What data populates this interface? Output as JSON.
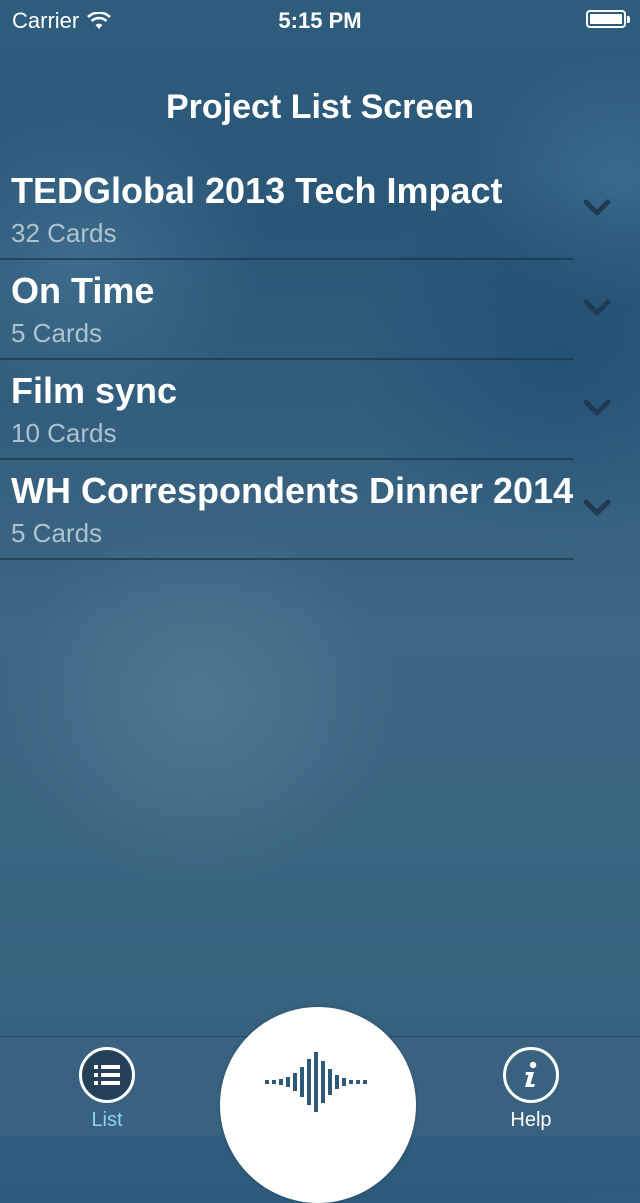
{
  "status_bar": {
    "carrier": "Carrier",
    "time": "5:15 PM",
    "icons": [
      "wifi-icon",
      "battery-icon"
    ]
  },
  "header": {
    "title": "Project List Screen"
  },
  "projects": [
    {
      "name": "TEDGlobal 2013 Tech Impact",
      "count": "32 Cards"
    },
    {
      "name": "On Time",
      "count": "5 Cards"
    },
    {
      "name": "Film sync",
      "count": "10 Cards"
    },
    {
      "name": "WH Correspondents Dinner 2014",
      "count": "5 Cards"
    }
  ],
  "tab_bar": {
    "list_label": "List",
    "help_label": "Help",
    "record_icon": "waveform-icon",
    "list_icon": "list-icon",
    "help_icon": "info-icon"
  },
  "colors": {
    "background": "#2f5d7e",
    "active_tab": "#8cd0f3",
    "count_text": "#aec3d0",
    "waveform": "#2e5a78"
  }
}
